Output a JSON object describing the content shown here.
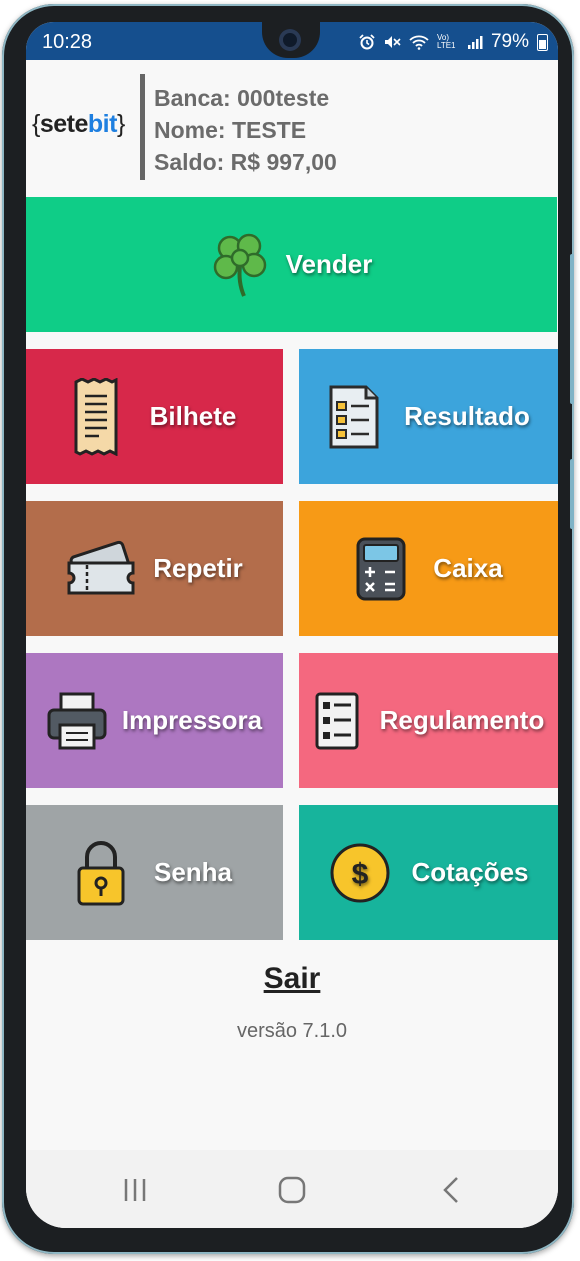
{
  "status_bar": {
    "time": "10:28",
    "signal_label": "Vo) LTE1",
    "battery": "79%"
  },
  "header": {
    "logo": {
      "brace_open": "{",
      "part1": "sete",
      "part2": "bit",
      "brace_close": "}"
    },
    "banca": "Banca: 000teste",
    "nome": "Nome: TESTE",
    "saldo": "Saldo: R$ 997,00"
  },
  "tiles": {
    "vender": {
      "label": "Vender",
      "color": "#0fcd87",
      "icon": "clover-icon"
    },
    "bilhete": {
      "label": "Bilhete",
      "color": "#d7284a",
      "icon": "receipt-icon"
    },
    "resultado": {
      "label": "Resultado",
      "color": "#3ca4dc",
      "icon": "checklist-icon"
    },
    "repetir": {
      "label": "Repetir",
      "color": "#b36d4b",
      "icon": "tickets-icon"
    },
    "caixa": {
      "label": "Caixa",
      "color": "#f79a16",
      "icon": "calculator-icon"
    },
    "impressora": {
      "label": "Impressora",
      "color": "#ad77c1",
      "icon": "printer-icon"
    },
    "regulamento": {
      "label": "Regulamento",
      "color": "#f4687f",
      "icon": "list-icon"
    },
    "senha": {
      "label": "Senha",
      "color": "#9fa4a6",
      "icon": "padlock-icon"
    },
    "cotacoes": {
      "label": "Cotações",
      "color": "#17b49c",
      "icon": "dollar-coin-icon"
    }
  },
  "footer": {
    "logout": "Sair",
    "version": "versão 7.1.0"
  },
  "nav": {
    "recents": "recents-icon",
    "home": "home-icon",
    "back": "back-icon"
  }
}
